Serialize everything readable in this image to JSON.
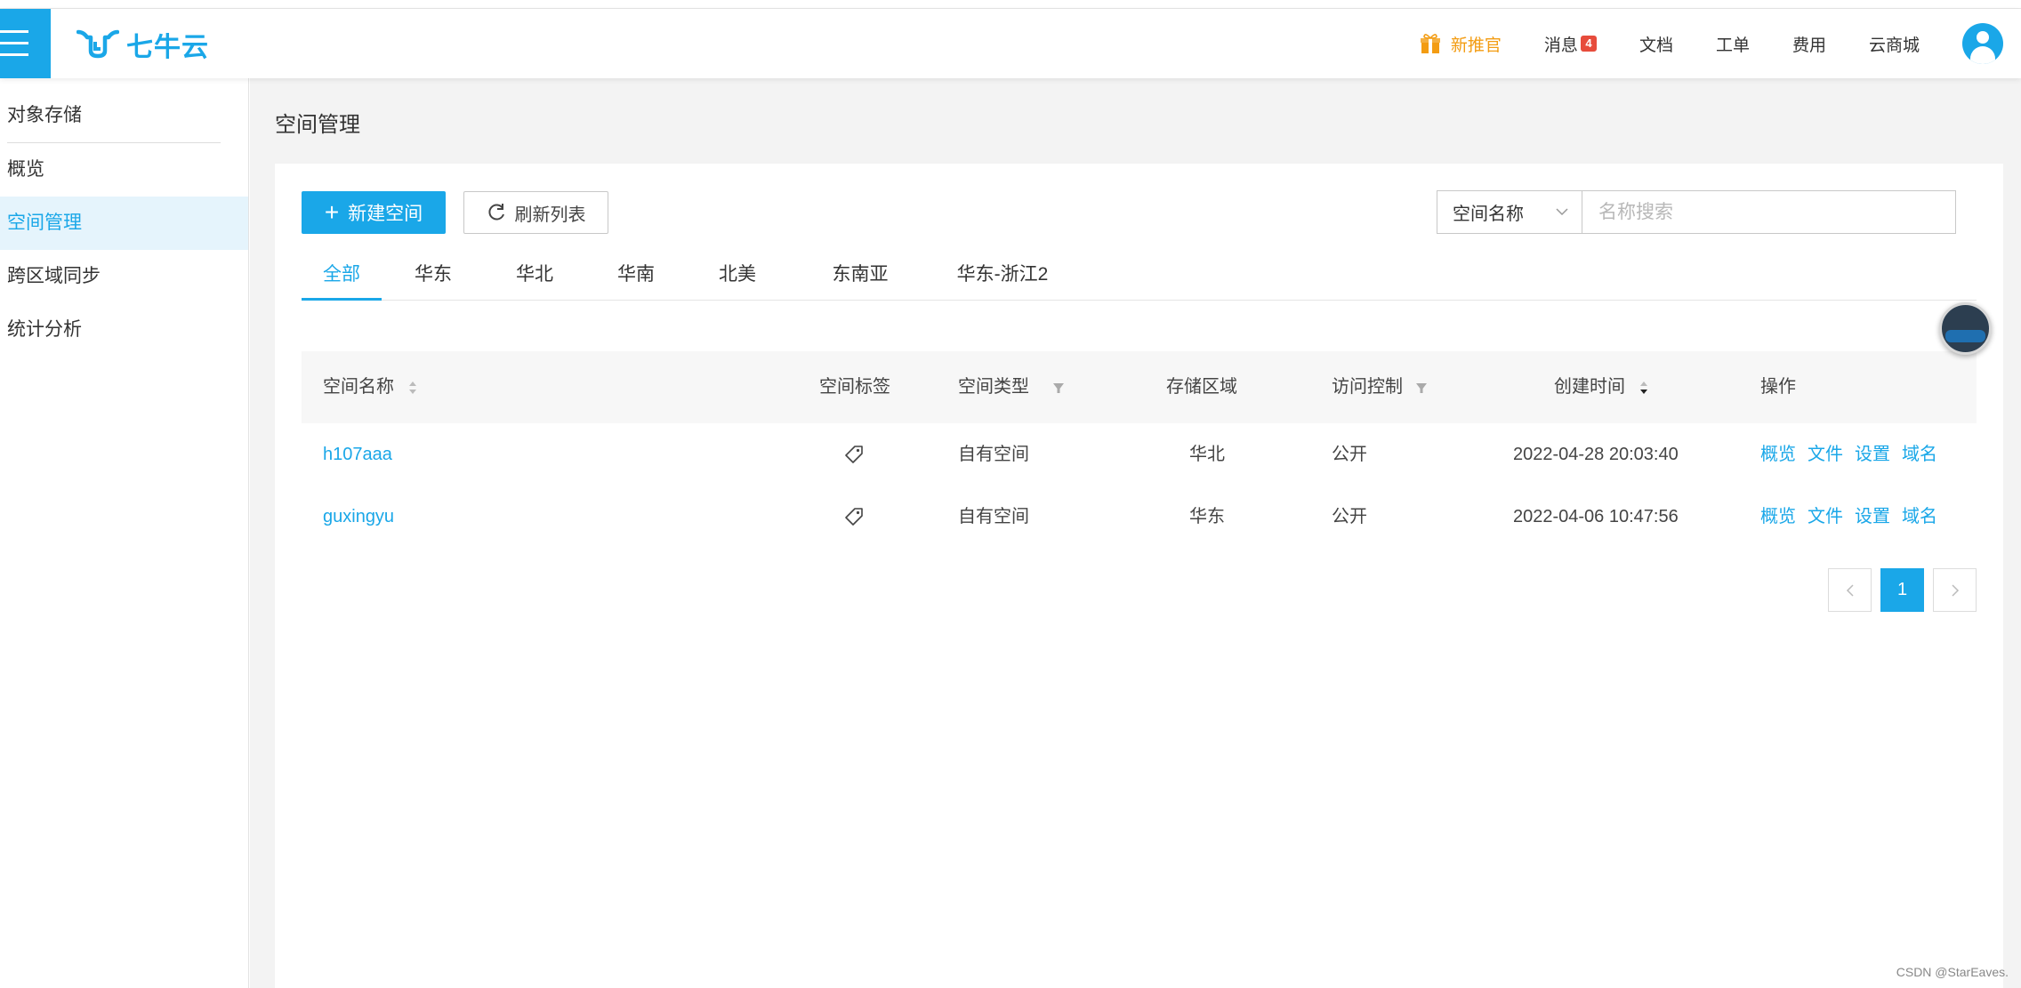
{
  "brand": {
    "name": "七牛云"
  },
  "topnav": {
    "promo": "新推官",
    "messages": "消息",
    "message_count": "4",
    "docs": "文档",
    "tickets": "工单",
    "billing": "费用",
    "marketplace": "云商城"
  },
  "sidebar": {
    "title": "对象存储",
    "items": [
      {
        "label": "概览"
      },
      {
        "label": "空间管理"
      },
      {
        "label": "跨区域同步"
      },
      {
        "label": "统计分析"
      }
    ]
  },
  "page": {
    "title": "空间管理"
  },
  "toolbar": {
    "new_bucket": "新建空间",
    "refresh": "刷新列表",
    "search_field": "空间名称",
    "search_placeholder": "名称搜索"
  },
  "region_tabs": [
    "全部",
    "华东",
    "华北",
    "华南",
    "北美",
    "东南亚",
    "华东-浙江2"
  ],
  "table": {
    "columns": {
      "name": "空间名称",
      "tags": "空间标签",
      "type": "空间类型",
      "region": "存储区域",
      "access": "访问控制",
      "created": "创建时间",
      "ops": "操作"
    },
    "rows": [
      {
        "name": "h107aaa",
        "type": "自有空间",
        "region": "华北",
        "access": "公开",
        "created": "2022-04-28 20:03:40"
      },
      {
        "name": "guxingyu",
        "type": "自有空间",
        "region": "华东",
        "access": "公开",
        "created": "2022-04-06 10:47:56"
      }
    ],
    "actions": [
      "概览",
      "文件",
      "设置",
      "域名"
    ]
  },
  "pagination": {
    "current": "1"
  },
  "watermark": "CSDN @StarEaves.",
  "colors": {
    "accent": "#1aa7e8",
    "promo": "#f39c12",
    "badge": "#e74c3c"
  }
}
